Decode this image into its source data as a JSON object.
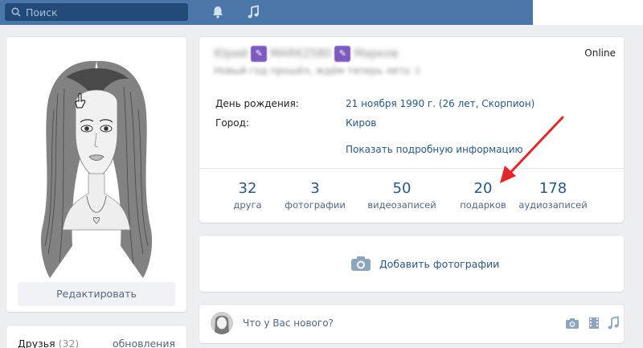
{
  "topbar": {
    "search_placeholder": "Поиск",
    "icons": [
      "search-icon",
      "bell-icon",
      "music-icon"
    ]
  },
  "profile": {
    "name_first": "Юрий",
    "name_middle": "MARK2580",
    "name_last": "Марков",
    "status": "Новый год прошёл, ждём теперь лето :)",
    "online": "Online",
    "birthday_label": "День рождения:",
    "birthday_value": "21 ноября 1990 г. (26 лет, Скорпион)",
    "city_label": "Город:",
    "city_value": "Киров",
    "more_link": "Показать подробную информацию"
  },
  "counters": [
    {
      "num": "32",
      "label": "друга"
    },
    {
      "num": "3",
      "label": "фотографии"
    },
    {
      "num": "50",
      "label": "видеозаписей"
    },
    {
      "num": "20",
      "label": "подарков"
    },
    {
      "num": "178",
      "label": "аудиозаписей"
    }
  ],
  "avatar": {
    "edit_label": "Редактировать"
  },
  "friends": {
    "title": "Друзья",
    "count": "(32)",
    "updates": "обновления"
  },
  "photos": {
    "add_label": "Добавить фотографии"
  },
  "post": {
    "placeholder": "Что у Вас нового?"
  },
  "colors": {
    "header": "#4a76a8",
    "link": "#2a5885",
    "arrow": "#e0282b",
    "badge": "#7c5bbf"
  }
}
